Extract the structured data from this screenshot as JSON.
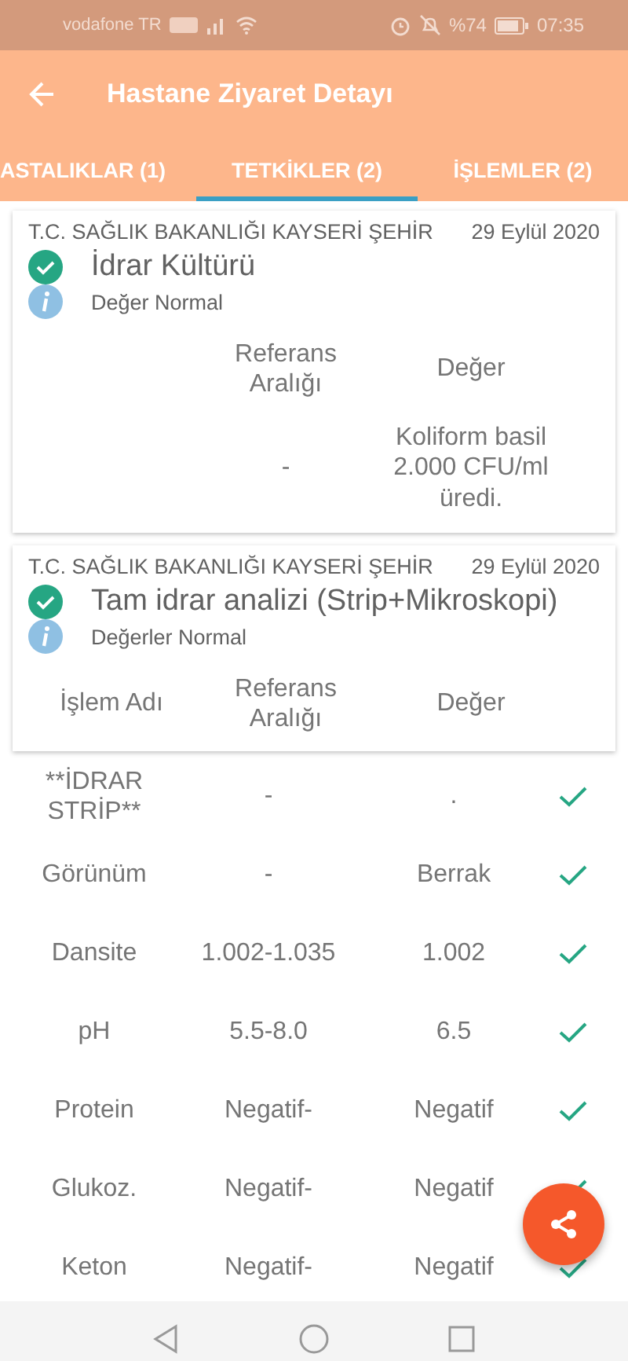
{
  "status_bar": {
    "carrier": "vodafone TR",
    "battery": "%74",
    "time": "07:35"
  },
  "app_bar": {
    "title": "Hastane Ziyaret Detayı"
  },
  "tabs": [
    {
      "label": "ASTALIKLAR (1)",
      "selected": false
    },
    {
      "label": "TETKİKLER (2)",
      "selected": true
    },
    {
      "label": "İŞLEMLER (2)",
      "selected": false
    }
  ],
  "cards": [
    {
      "hospital": "T.C. SAĞLIK BAKANLIĞI KAYSERİ ŞEHİR",
      "date": "29 Eylül 2020",
      "title": "İdrar Kültürü",
      "verified": true,
      "status": "Değer Normal",
      "columns": [
        "",
        "Referans Aralığı",
        "Değer"
      ],
      "rows": [
        {
          "name": "",
          "reference": "-",
          "value": "Koliform basil 2.000 CFU/ml üredi."
        }
      ]
    },
    {
      "hospital": "T.C. SAĞLIK BAKANLIĞI KAYSERİ ŞEHİR",
      "date": "29 Eylül 2020",
      "title": "Tam idrar analizi (Strip+Mikroskopi)",
      "verified": true,
      "status": "Değerler Normal",
      "columns": [
        "İşlem Adı",
        "Referans Aralığı",
        "Değer"
      ]
    }
  ],
  "results": [
    {
      "name": "**İDRAR STRİP**",
      "reference": "-",
      "value": ".",
      "normal": true
    },
    {
      "name": "Görünüm",
      "reference": "-",
      "value": "Berrak",
      "normal": true
    },
    {
      "name": "Dansite",
      "reference": "1.002-1.035",
      "value": "1.002",
      "normal": true
    },
    {
      "name": "pH",
      "reference": "5.5-8.0",
      "value": "6.5",
      "normal": true
    },
    {
      "name": "Protein",
      "reference": "Negatif-",
      "value": "Negatif",
      "normal": true
    },
    {
      "name": "Glukoz.",
      "reference": "Negatif-",
      "value": "Negatif",
      "normal": true
    },
    {
      "name": "Keton",
      "reference": "Negatif-",
      "value": "Negatif",
      "normal": true
    }
  ]
}
